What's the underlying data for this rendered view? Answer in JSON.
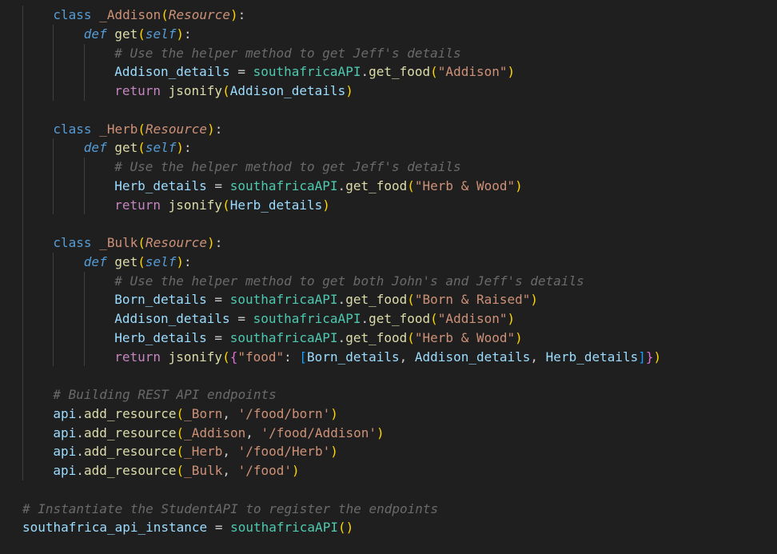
{
  "editor": {
    "lines": [
      {
        "indent": 1,
        "tokens": [
          {
            "t": "class ",
            "c": "kw"
          },
          {
            "t": "_Addison",
            "c": "cls"
          },
          {
            "t": "(",
            "c": "p1"
          },
          {
            "t": "Resource",
            "c": "base"
          },
          {
            "t": ")",
            "c": "p1"
          },
          {
            "t": ":",
            "c": "plain"
          }
        ]
      },
      {
        "indent": 2,
        "tokens": [
          {
            "t": "def ",
            "c": "def"
          },
          {
            "t": "get",
            "c": "fn"
          },
          {
            "t": "(",
            "c": "p1"
          },
          {
            "t": "self",
            "c": "self"
          },
          {
            "t": ")",
            "c": "p1"
          },
          {
            "t": ":",
            "c": "plain"
          }
        ]
      },
      {
        "indent": 3,
        "tokens": [
          {
            "t": "# Use the helper method to get Jeff's details",
            "c": "cmt"
          }
        ]
      },
      {
        "indent": 3,
        "tokens": [
          {
            "t": "Addison_details",
            "c": "var"
          },
          {
            "t": " = ",
            "c": "plain"
          },
          {
            "t": "southafricaAPI",
            "c": "obj"
          },
          {
            "t": ".",
            "c": "plain"
          },
          {
            "t": "get_food",
            "c": "fn"
          },
          {
            "t": "(",
            "c": "p1"
          },
          {
            "t": "\"Addison\"",
            "c": "str"
          },
          {
            "t": ")",
            "c": "p1"
          }
        ]
      },
      {
        "indent": 3,
        "tokens": [
          {
            "t": "return ",
            "c": "ret"
          },
          {
            "t": "jsonify",
            "c": "fn"
          },
          {
            "t": "(",
            "c": "p1"
          },
          {
            "t": "Addison_details",
            "c": "var"
          },
          {
            "t": ")",
            "c": "p1"
          }
        ]
      },
      {
        "indent": 0,
        "tokens": []
      },
      {
        "indent": 1,
        "tokens": [
          {
            "t": "class ",
            "c": "kw"
          },
          {
            "t": "_Herb",
            "c": "cls"
          },
          {
            "t": "(",
            "c": "p1"
          },
          {
            "t": "Resource",
            "c": "base"
          },
          {
            "t": ")",
            "c": "p1"
          },
          {
            "t": ":",
            "c": "plain"
          }
        ]
      },
      {
        "indent": 2,
        "tokens": [
          {
            "t": "def ",
            "c": "def"
          },
          {
            "t": "get",
            "c": "fn"
          },
          {
            "t": "(",
            "c": "p1"
          },
          {
            "t": "self",
            "c": "self"
          },
          {
            "t": ")",
            "c": "p1"
          },
          {
            "t": ":",
            "c": "plain"
          }
        ]
      },
      {
        "indent": 3,
        "tokens": [
          {
            "t": "# Use the helper method to get Jeff's details",
            "c": "cmt"
          }
        ]
      },
      {
        "indent": 3,
        "tokens": [
          {
            "t": "Herb_details",
            "c": "var"
          },
          {
            "t": " = ",
            "c": "plain"
          },
          {
            "t": "southafricaAPI",
            "c": "obj"
          },
          {
            "t": ".",
            "c": "plain"
          },
          {
            "t": "get_food",
            "c": "fn"
          },
          {
            "t": "(",
            "c": "p1"
          },
          {
            "t": "\"Herb & Wood\"",
            "c": "str"
          },
          {
            "t": ")",
            "c": "p1"
          }
        ]
      },
      {
        "indent": 3,
        "tokens": [
          {
            "t": "return ",
            "c": "ret"
          },
          {
            "t": "jsonify",
            "c": "fn"
          },
          {
            "t": "(",
            "c": "p1"
          },
          {
            "t": "Herb_details",
            "c": "var"
          },
          {
            "t": ")",
            "c": "p1"
          }
        ]
      },
      {
        "indent": 0,
        "tokens": []
      },
      {
        "indent": 1,
        "tokens": [
          {
            "t": "class ",
            "c": "kw"
          },
          {
            "t": "_Bulk",
            "c": "cls"
          },
          {
            "t": "(",
            "c": "p1"
          },
          {
            "t": "Resource",
            "c": "base"
          },
          {
            "t": ")",
            "c": "p1"
          },
          {
            "t": ":",
            "c": "plain"
          }
        ]
      },
      {
        "indent": 2,
        "tokens": [
          {
            "t": "def ",
            "c": "def"
          },
          {
            "t": "get",
            "c": "fn"
          },
          {
            "t": "(",
            "c": "p1"
          },
          {
            "t": "self",
            "c": "self"
          },
          {
            "t": ")",
            "c": "p1"
          },
          {
            "t": ":",
            "c": "plain"
          }
        ]
      },
      {
        "indent": 3,
        "tokens": [
          {
            "t": "# Use the helper method to get both John's and Jeff's details",
            "c": "cmt"
          }
        ]
      },
      {
        "indent": 3,
        "tokens": [
          {
            "t": "Born_details",
            "c": "var"
          },
          {
            "t": " = ",
            "c": "plain"
          },
          {
            "t": "southafricaAPI",
            "c": "obj"
          },
          {
            "t": ".",
            "c": "plain"
          },
          {
            "t": "get_food",
            "c": "fn"
          },
          {
            "t": "(",
            "c": "p1"
          },
          {
            "t": "\"Born & Raised\"",
            "c": "str"
          },
          {
            "t": ")",
            "c": "p1"
          }
        ]
      },
      {
        "indent": 3,
        "tokens": [
          {
            "t": "Addison_details",
            "c": "var"
          },
          {
            "t": " = ",
            "c": "plain"
          },
          {
            "t": "southafricaAPI",
            "c": "obj"
          },
          {
            "t": ".",
            "c": "plain"
          },
          {
            "t": "get_food",
            "c": "fn"
          },
          {
            "t": "(",
            "c": "p1"
          },
          {
            "t": "\"Addison\"",
            "c": "str"
          },
          {
            "t": ")",
            "c": "p1"
          }
        ]
      },
      {
        "indent": 3,
        "tokens": [
          {
            "t": "Herb_details",
            "c": "var"
          },
          {
            "t": " = ",
            "c": "plain"
          },
          {
            "t": "southafricaAPI",
            "c": "obj"
          },
          {
            "t": ".",
            "c": "plain"
          },
          {
            "t": "get_food",
            "c": "fn"
          },
          {
            "t": "(",
            "c": "p1"
          },
          {
            "t": "\"Herb & Wood\"",
            "c": "str"
          },
          {
            "t": ")",
            "c": "p1"
          }
        ]
      },
      {
        "indent": 3,
        "tokens": [
          {
            "t": "return ",
            "c": "ret"
          },
          {
            "t": "jsonify",
            "c": "fn"
          },
          {
            "t": "(",
            "c": "p1"
          },
          {
            "t": "{",
            "c": "p2"
          },
          {
            "t": "\"food\"",
            "c": "str"
          },
          {
            "t": ": ",
            "c": "plain"
          },
          {
            "t": "[",
            "c": "p3"
          },
          {
            "t": "Born_details",
            "c": "var"
          },
          {
            "t": ", ",
            "c": "plain"
          },
          {
            "t": "Addison_details",
            "c": "var"
          },
          {
            "t": ", ",
            "c": "plain"
          },
          {
            "t": "Herb_details",
            "c": "var"
          },
          {
            "t": "]",
            "c": "p3"
          },
          {
            "t": "}",
            "c": "p2"
          },
          {
            "t": ")",
            "c": "p1"
          }
        ]
      },
      {
        "indent": 0,
        "tokens": []
      },
      {
        "indent": 1,
        "tokens": [
          {
            "t": "# Building REST API endpoints",
            "c": "cmt"
          }
        ]
      },
      {
        "indent": 1,
        "tokens": [
          {
            "t": "api",
            "c": "var"
          },
          {
            "t": ".",
            "c": "plain"
          },
          {
            "t": "add_resource",
            "c": "fn"
          },
          {
            "t": "(",
            "c": "p1"
          },
          {
            "t": "_Born",
            "c": "cls"
          },
          {
            "t": ", ",
            "c": "plain"
          },
          {
            "t": "'/food/born'",
            "c": "str"
          },
          {
            "t": ")",
            "c": "p1"
          }
        ]
      },
      {
        "indent": 1,
        "tokens": [
          {
            "t": "api",
            "c": "var"
          },
          {
            "t": ".",
            "c": "plain"
          },
          {
            "t": "add_resource",
            "c": "fn"
          },
          {
            "t": "(",
            "c": "p1"
          },
          {
            "t": "_Addison",
            "c": "cls"
          },
          {
            "t": ", ",
            "c": "plain"
          },
          {
            "t": "'/food/Addison'",
            "c": "str"
          },
          {
            "t": ")",
            "c": "p1"
          }
        ]
      },
      {
        "indent": 1,
        "tokens": [
          {
            "t": "api",
            "c": "var"
          },
          {
            "t": ".",
            "c": "plain"
          },
          {
            "t": "add_resource",
            "c": "fn"
          },
          {
            "t": "(",
            "c": "p1"
          },
          {
            "t": "_Herb",
            "c": "cls"
          },
          {
            "t": ", ",
            "c": "plain"
          },
          {
            "t": "'/food/Herb'",
            "c": "str"
          },
          {
            "t": ")",
            "c": "p1"
          }
        ]
      },
      {
        "indent": 1,
        "tokens": [
          {
            "t": "api",
            "c": "var"
          },
          {
            "t": ".",
            "c": "plain"
          },
          {
            "t": "add_resource",
            "c": "fn"
          },
          {
            "t": "(",
            "c": "p1"
          },
          {
            "t": "_Bulk",
            "c": "cls"
          },
          {
            "t": ", ",
            "c": "plain"
          },
          {
            "t": "'/food'",
            "c": "str"
          },
          {
            "t": ")",
            "c": "p1"
          }
        ]
      },
      {
        "indent": 0,
        "tokens": []
      },
      {
        "indent": 0,
        "tokens": [
          {
            "t": "# Instantiate the StudentAPI to register the endpoints",
            "c": "cmt"
          }
        ]
      },
      {
        "indent": 0,
        "tokens": [
          {
            "t": "southafrica_api_instance",
            "c": "var"
          },
          {
            "t": " = ",
            "c": "plain"
          },
          {
            "t": "southafricaAPI",
            "c": "obj"
          },
          {
            "t": "(",
            "c": "p1"
          },
          {
            "t": ")",
            "c": "p1"
          }
        ]
      }
    ]
  }
}
